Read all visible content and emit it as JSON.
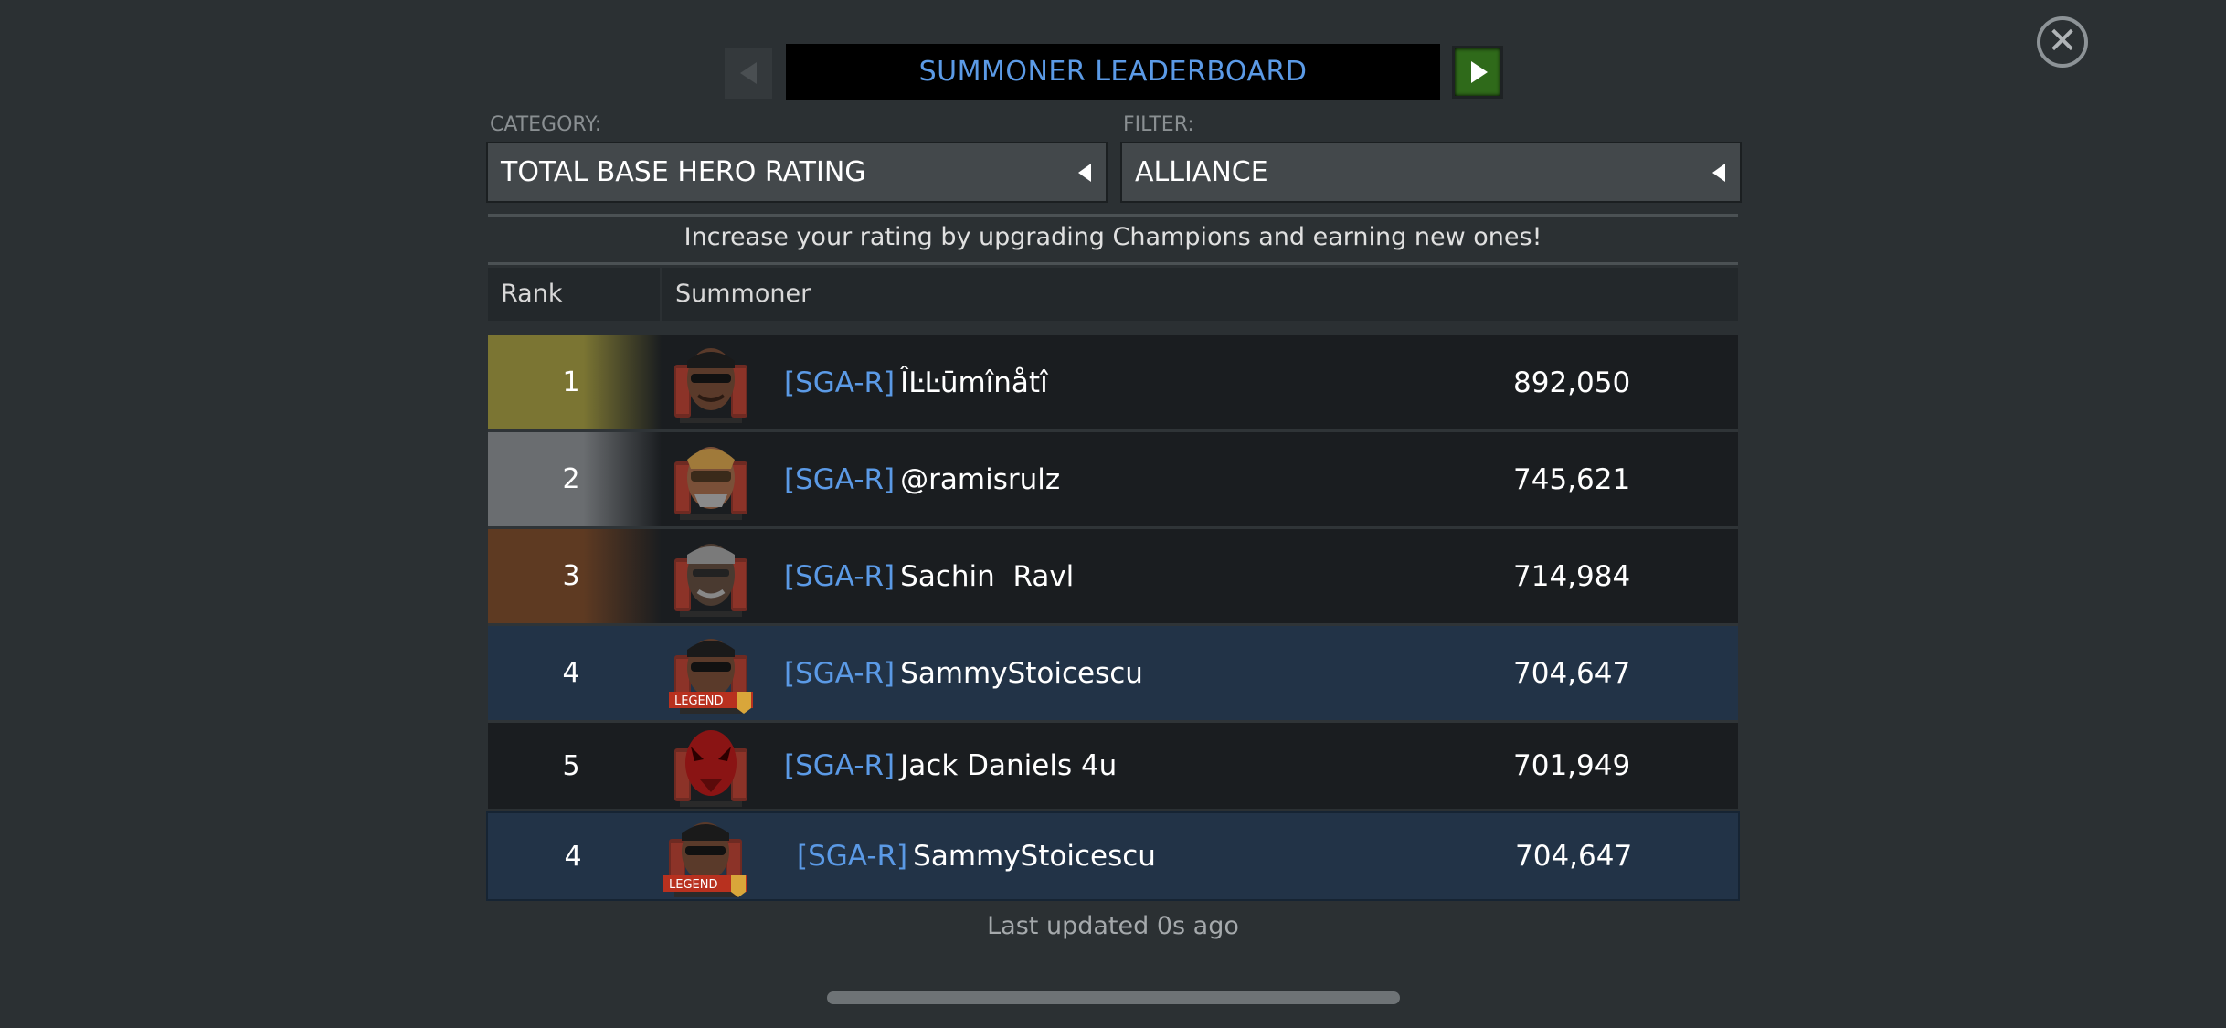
{
  "header": {
    "title": "SUMMONER LEADERBOARD"
  },
  "category": {
    "label": "CATEGORY:",
    "value": "TOTAL BASE HERO RATING"
  },
  "filter": {
    "label": "FILTER:",
    "value": "ALLIANCE"
  },
  "hint": "Increase your rating by upgrading Champions and earning new ones!",
  "table": {
    "columns": [
      "Rank",
      "Summoner"
    ],
    "rows": [
      {
        "rank": "1",
        "tag": "[SGA-R]",
        "name": "ÎĿĿūmînåtî",
        "score": "892,050",
        "tier": "gold"
      },
      {
        "rank": "2",
        "tag": "[SGA-R]",
        "name": "@ramisrulz",
        "score": "745,621",
        "tier": "silver"
      },
      {
        "rank": "3",
        "tag": "[SGA-R]",
        "name": "Sachin  Ravl",
        "score": "714,984",
        "tier": "bronze"
      },
      {
        "rank": "4",
        "tag": "[SGA-R]",
        "name": "SammyStoicescu",
        "score": "704,647",
        "tier": "self",
        "badge": "LEGEND"
      },
      {
        "rank": "5",
        "tag": "[SGA-R]",
        "name": "Jack Daniels 4u",
        "score": "701,949",
        "tier": "none"
      }
    ]
  },
  "my_entry": {
    "rank": "4",
    "tag": "[SGA-R]",
    "name": "SammyStoicescu",
    "score": "704,647",
    "badge": "LEGEND"
  },
  "footer": "Last updated 0s ago",
  "colors": {
    "accent_blue": "#5b9ae6",
    "next_button": "#2f6a1a",
    "self_row": "#223347"
  }
}
